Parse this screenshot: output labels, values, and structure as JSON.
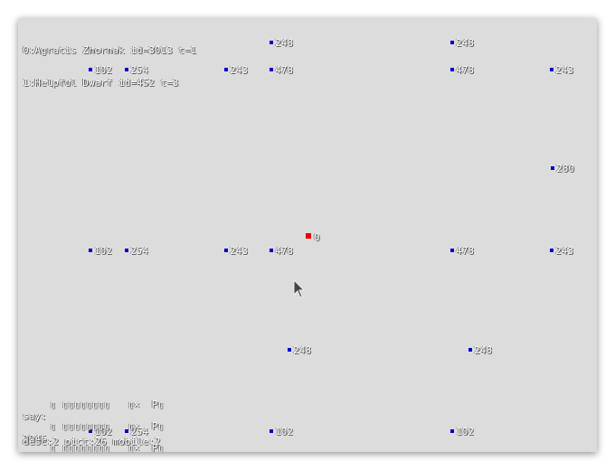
{
  "hud": {
    "players": [
      "0:Agratis Zhornak id=3013 t=1",
      "1:Helpful Dwarf id=452 t=3"
    ],
    "say_label": "say:",
    "garbled_lines": [
      "▯ ▯▯▯▯▯▯▯▯   ▯×  P▯",
      "▯ ▯▯▯▯▯▯▯▯   ▯×  P▯",
      "▯ ▯▯▯▯▯▯▯▯   ▯×  P▯"
    ],
    "status_line": "desc:2 pict:26 mobile:2",
    "status_overlap": "2046"
  },
  "colors": {
    "background": "#dcdcdc",
    "entity": "#0000cc",
    "player": "#ee0000"
  },
  "entities": [
    {
      "id": "248"
    },
    {
      "id": "248"
    },
    {
      "id": "102"
    },
    {
      "id": "254"
    },
    {
      "id": "243"
    },
    {
      "id": "478"
    },
    {
      "id": "478"
    },
    {
      "id": "243"
    },
    {
      "id": "280"
    },
    {
      "id": "0",
      "player": true
    },
    {
      "id": "102"
    },
    {
      "id": "254"
    },
    {
      "id": "243"
    },
    {
      "id": "478"
    },
    {
      "id": "478"
    },
    {
      "id": "243"
    },
    {
      "id": "248"
    },
    {
      "id": "248"
    },
    {
      "id": "102"
    },
    {
      "id": "254"
    },
    {
      "id": "102"
    },
    {
      "id": "102"
    }
  ]
}
